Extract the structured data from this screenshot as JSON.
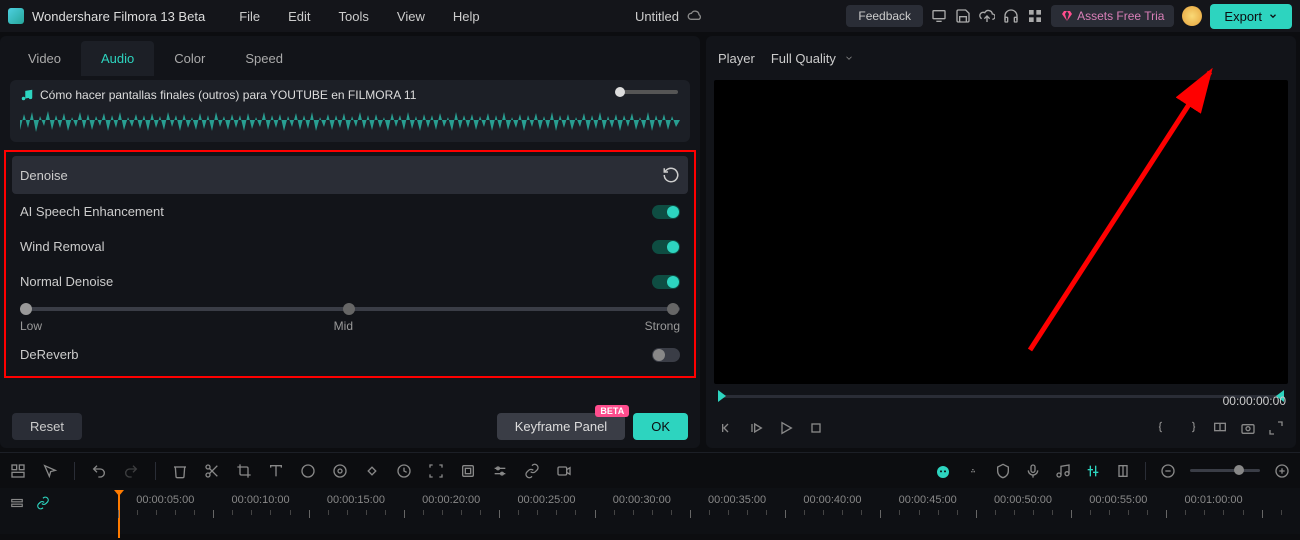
{
  "app": {
    "name": "Wondershare Filmora 13 Beta"
  },
  "menu": [
    "File",
    "Edit",
    "Tools",
    "View",
    "Help"
  ],
  "project": {
    "title": "Untitled"
  },
  "topbar": {
    "feedback": "Feedback",
    "assets_trial": "Assets Free Tria",
    "export": "Export"
  },
  "tabs": {
    "items": [
      "Video",
      "Audio",
      "Color",
      "Speed"
    ],
    "active": 1
  },
  "clip": {
    "title": "Cómo hacer pantallas finales (outros) para YOUTUBE en FILMORA 11"
  },
  "denoise": {
    "header": "Denoise",
    "ai_speech": {
      "label": "AI Speech Enhancement",
      "on": true
    },
    "wind": {
      "label": "Wind Removal",
      "on": true
    },
    "normal": {
      "label": "Normal Denoise",
      "on": true
    },
    "slider": {
      "low": "Low",
      "mid": "Mid",
      "strong": "Strong",
      "value_pct": 0
    },
    "dereverb": {
      "label": "DeReverb",
      "on": false
    }
  },
  "buttons": {
    "reset": "Reset",
    "keyframe": "Keyframe Panel",
    "beta": "BETA",
    "ok": "OK"
  },
  "player": {
    "label": "Player",
    "quality": "Full Quality",
    "time": "00:00:00:00"
  },
  "timeline": {
    "labels": [
      "00:00:05:00",
      "00:00:10:00",
      "00:00:15:00",
      "00:00:20:00",
      "00:00:25:00",
      "00:00:30:00",
      "00:00:35:00",
      "00:00:40:00",
      "00:00:45:00",
      "00:00:50:00",
      "00:00:55:00",
      "00:01:00:00"
    ]
  }
}
